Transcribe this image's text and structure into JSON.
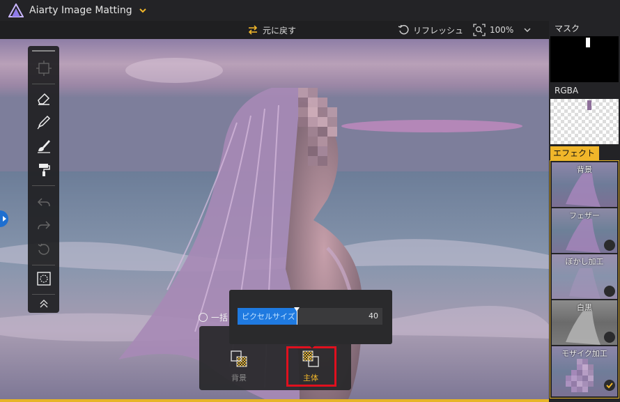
{
  "app": {
    "title": "Aiarty Image Matting"
  },
  "toolbar": {
    "undo_label": "元に戻す",
    "refresh_label": "リフレッシュ",
    "zoom_label": "100%"
  },
  "tools": [
    "select-tool",
    "eraser",
    "brush",
    "restore-brush",
    "roller",
    "undo",
    "redo",
    "reset",
    "view-toggle",
    "collapse"
  ],
  "right_panel": {
    "mask_label": "マスク",
    "rgba_label": "RGBA",
    "effects_label": "エフェクト",
    "effects": [
      {
        "name": "背景",
        "selected": false
      },
      {
        "name": "フェザー",
        "selected": false
      },
      {
        "name": "ぼかし加工",
        "selected": false
      },
      {
        "name": "白黒",
        "selected": false
      },
      {
        "name": "モザイク加工",
        "selected": true
      }
    ]
  },
  "mosaic_popup": {
    "slider_label": "ピクセルサイズ",
    "value": "40",
    "fill_fraction": 0.41
  },
  "batch": {
    "label": "一括"
  },
  "modes": {
    "background_label": "背景",
    "subject_label": "主体"
  },
  "colors": {
    "accent": "#e6b428",
    "slider": "#1f7ae0",
    "highlight": "#e0101e"
  }
}
